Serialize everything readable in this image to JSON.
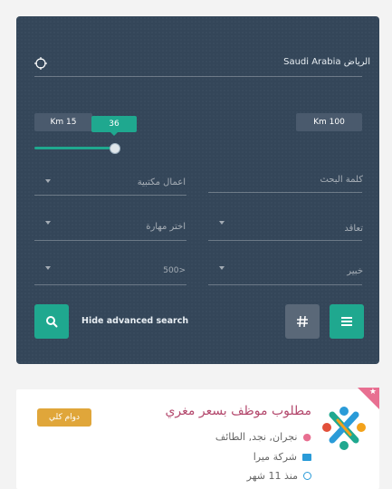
{
  "search": {
    "location_value": "الرياض Saudi Arabia",
    "km_min": "Km 15",
    "km_max": "Km 100",
    "slider_value": "36",
    "keyword_placeholder": "كلمة البحث",
    "category_value": "اعمال مكتبية",
    "contract_value": "تعاقد",
    "skill_value": "اختر مهارة",
    "experience_value": "خبير",
    "salary_value": "500>",
    "toggle_label": "Hide advanced search"
  },
  "job": {
    "title": "مطلوب موظف بسعر مغري",
    "type_badge": "دوام كلي",
    "location": "نجران, نجد, الطائف",
    "company": "شركة ميرا",
    "posted": "منذ 11 شهر"
  },
  "colors": {
    "panel": "#344659",
    "accent_green": "#1fa88f",
    "badge_orange": "#e0a63a",
    "title_pink": "#b44a6e",
    "ribbon": "#e86f91"
  },
  "icons": [
    "crosshair-icon",
    "search-icon",
    "hash-icon",
    "list-icon",
    "map-pin-icon",
    "briefcase-icon",
    "clock-icon",
    "star-icon"
  ]
}
